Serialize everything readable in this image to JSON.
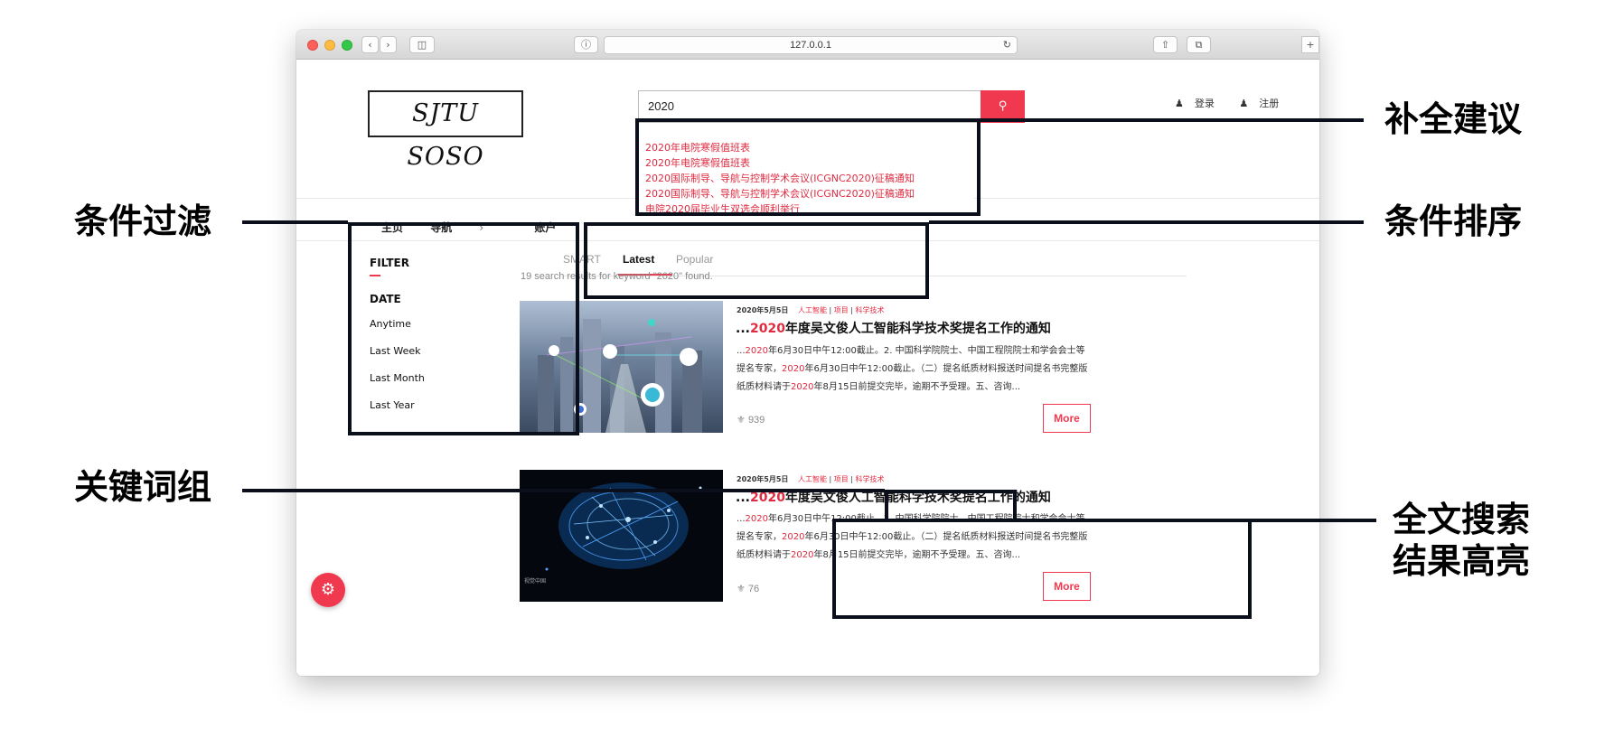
{
  "browser": {
    "url": "127.0.0.1",
    "back_icon": "chevron-left-icon",
    "forward_icon": "chevron-right-icon",
    "sidebar_icon": "sidebar-icon",
    "info_icon": "info-icon",
    "reload_icon": "reload-icon",
    "share_icon": "share-icon",
    "tabs_icon": "tabs-icon",
    "add_tab_icon": "plus-icon"
  },
  "header": {
    "logo": "SJTU SOSO",
    "search_value": "2020",
    "login": "登录",
    "register": "注册"
  },
  "nav": {
    "items": [
      "主页",
      "导航",
      "账户"
    ]
  },
  "suggestions": [
    "2020年电院寒假值班表",
    "2020年电院寒假值班表",
    "2020国际制导、导航与控制学术会议(ICGNC2020)征稿通知",
    "2020国际制导、导航与控制学术会议(ICGNC2020)征稿通知",
    "电院2020届毕业生双选会顺利举行"
  ],
  "filter": {
    "title": "FILTER",
    "section": "DATE",
    "options": [
      "Anytime",
      "Last Week",
      "Last Month",
      "Last Year"
    ]
  },
  "tabs": [
    "SMART",
    "Latest",
    "Popular"
  ],
  "active_tab": "Latest",
  "result_count_text": "19 search results for keyword \"2020\" found.",
  "results": [
    {
      "date": "2020年5月5日",
      "categories": [
        "人工智能",
        "项目",
        "科学技术"
      ],
      "title_prefix": "...",
      "title_hl": "2020",
      "title_rest": "年度吴文俊人工智能科学技术奖提名工作的通知",
      "snippet": [
        {
          "t": "...",
          "h": false
        },
        {
          "t": "2020",
          "h": true
        },
        {
          "t": "年6月30日中午12:00截止。2. 中国科学院院士、中国工程院院士和学会会士等提名专家，",
          "h": false
        },
        {
          "t": "2020",
          "h": true
        },
        {
          "t": "年6月30日中午12:00截止。（二）提名纸质材料报送时间提名书完整版纸质材料请于",
          "h": false
        },
        {
          "t": "2020",
          "h": true
        },
        {
          "t": "年8月15日前提交完毕，逾期不予受理。五、咨询...",
          "h": false
        }
      ],
      "views": "939",
      "more": "More"
    },
    {
      "date": "2020年5月5日",
      "categories": [
        "人工智能",
        "项目",
        "科学技术"
      ],
      "title_prefix": "...",
      "title_hl": "2020",
      "title_rest": "年度吴文俊人工智能科学技术奖提名工作的通知",
      "snippet": [
        {
          "t": "...",
          "h": false
        },
        {
          "t": "2020",
          "h": true
        },
        {
          "t": "年6月30日中午12:00截止。2. 中国科学院院士、中国工程院院士和学会会士等提名专家，",
          "h": false
        },
        {
          "t": "2020",
          "h": true
        },
        {
          "t": "年6月30日中午12:00截止。（二）提名纸质材料报送时间提名书完整版纸质材料请于",
          "h": false
        },
        {
          "t": "2020",
          "h": true
        },
        {
          "t": "年8月15日前提交完毕，逾期不予受理。五、咨询...",
          "h": false
        }
      ],
      "views": "76",
      "more": "More",
      "thumb_caption": "视觉中国"
    }
  ],
  "annotations": {
    "autocomplete": "补全建议",
    "filter": "条件过滤",
    "sort": "条件排序",
    "keyword_group": "关键词组",
    "highlight_line1": "全文搜索",
    "highlight_line2": "结果高亮"
  },
  "colors": {
    "accent": "#f0394f",
    "highlight_text": "#e02b40",
    "annotation": "#0b0f1c"
  }
}
